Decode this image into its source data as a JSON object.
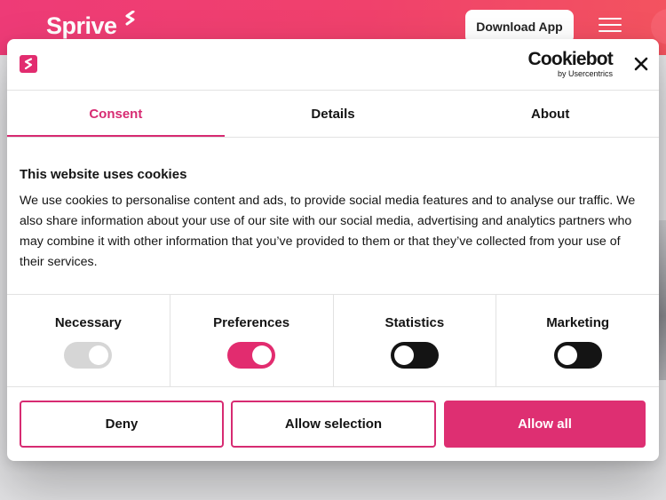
{
  "site": {
    "brand": "Sprive",
    "download_label": "Download App"
  },
  "dialog": {
    "cookiebot_word": "Cookiebot",
    "cookiebot_sub": "by Usercentrics",
    "tabs": [
      {
        "label": "Consent",
        "active": true
      },
      {
        "label": "Details",
        "active": false
      },
      {
        "label": "About",
        "active": false
      }
    ],
    "title": "This website uses cookies",
    "paragraph": "We use cookies to personalise content and ads, to provide social media features and to analyse our traffic. We also share information about your use of our site with our social media, advertising and analytics partners who may combine it with other information that you’ve provided to them or that they’ve collected from your use of their services.",
    "toggles": [
      {
        "label": "Necessary",
        "state": "on",
        "disabled": true
      },
      {
        "label": "Preferences",
        "state": "on",
        "disabled": false
      },
      {
        "label": "Statistics",
        "state": "off",
        "disabled": false
      },
      {
        "label": "Marketing",
        "state": "off",
        "disabled": false
      }
    ],
    "buttons": {
      "deny": "Deny",
      "allow_selection": "Allow selection",
      "allow_all": "Allow all"
    }
  },
  "colors": {
    "accent": "#d72b72",
    "header_gradient_start": "#ee3b77",
    "header_gradient_end": "#f3535f"
  },
  "icons": [
    "sprive-logo-icon",
    "hamburger-menu-icon",
    "close-icon"
  ]
}
